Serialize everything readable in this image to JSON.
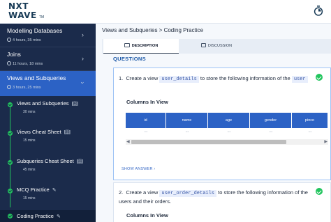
{
  "brand": {
    "line1": "NXT",
    "line2": "WAVE",
    "tm": "TM"
  },
  "sidebar": {
    "modules": [
      {
        "title": "Modelling Databases",
        "meta": "4 hours, 35 mins"
      },
      {
        "title": "Joins",
        "meta": "11 hours, 18 mins"
      },
      {
        "title": "Views and Subqueries",
        "meta": "3 hours, 25 mins"
      }
    ],
    "sub_items": [
      {
        "title": "Views and Subqueries",
        "meta": "30 mins"
      },
      {
        "title": "Views Cheat Sheet",
        "meta": "15 mins"
      },
      {
        "title": "Subqueries Cheat Sheet",
        "meta": "45 mins"
      },
      {
        "title": "MCQ Practice",
        "meta": "15 mins"
      },
      {
        "title": "Coding Practice"
      }
    ]
  },
  "main": {
    "breadcrumb": "Views and Subqueries > Coding Practice",
    "tabs": [
      {
        "label": "DESCRIPTION"
      },
      {
        "label": "DISCUSSION"
      }
    ],
    "questions_heading": "QUESTIONS",
    "questions": [
      {
        "number": "1.",
        "text_before": "Create a view",
        "code": "user_details",
        "text_middle": "to store the following information of the",
        "code2": "user",
        "view_heading": "Columns In View",
        "columns": [
          "id",
          "name",
          "age",
          "gender",
          "pinco"
        ],
        "row": [
          "...",
          "...",
          "...",
          "...",
          "..."
        ],
        "show_answer": "SHOW ANSWER"
      },
      {
        "number": "2.",
        "text_before": "Create a view",
        "code": "user_order_details",
        "text_after": "to store the following information of the users and their orders.",
        "view_heading": "Columns In View"
      }
    ]
  },
  "colors": {
    "sidebar_bg": "#1b2b4b",
    "accent": "#2c62c5",
    "success": "#22c55e"
  }
}
